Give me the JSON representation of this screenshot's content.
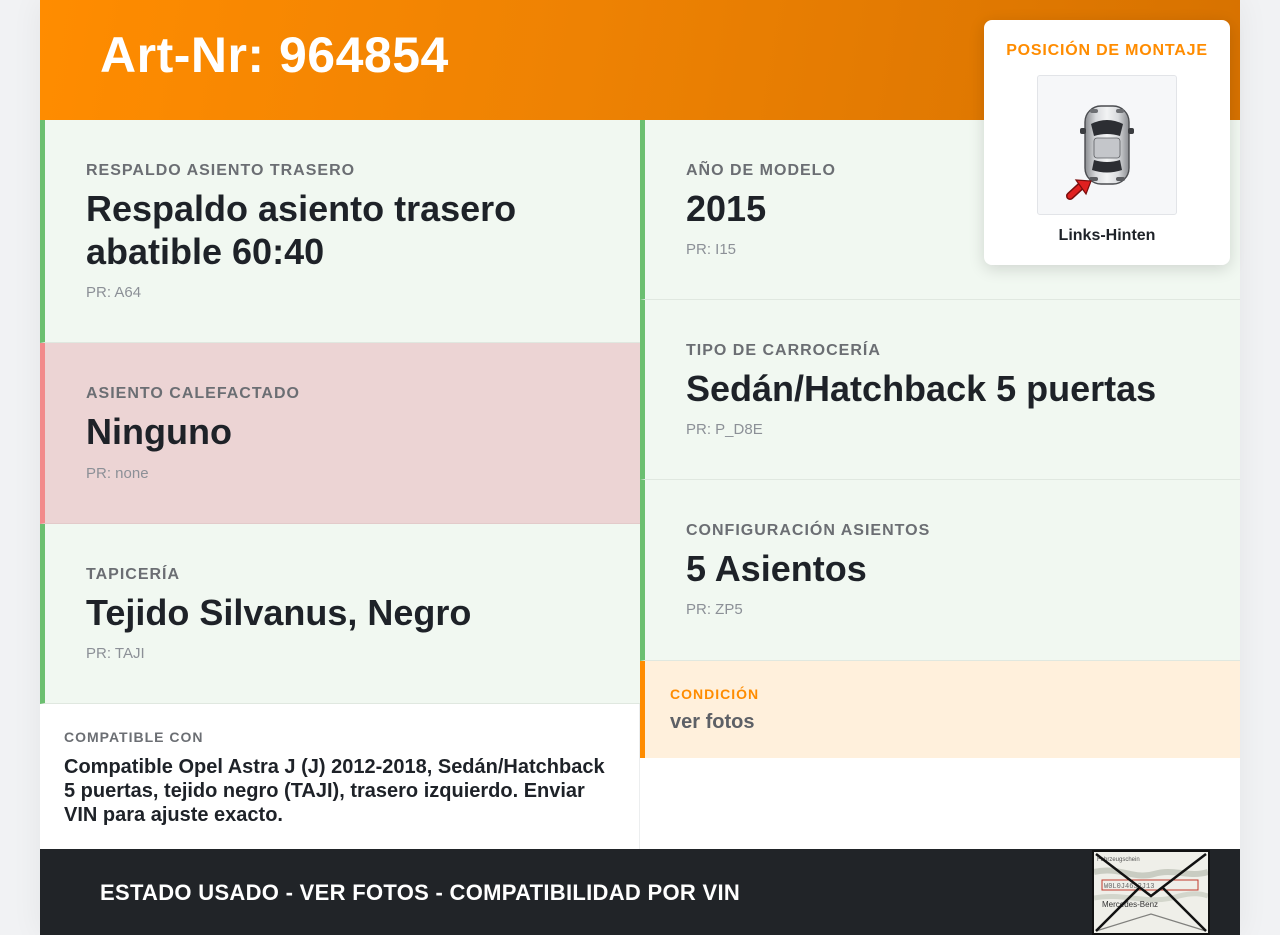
{
  "header": {
    "title": "Art-Nr: 964854"
  },
  "left_cells": [
    {
      "label": "RESPALDO ASIENTO TRASERO",
      "value": "Respaldo asiento trasero abatible 60:40",
      "pr": "PR: A64",
      "status": "ok"
    },
    {
      "label": "ASIENTO CALEFACTADO",
      "value": "Ninguno",
      "pr": "PR: none",
      "status": "missing"
    },
    {
      "label": "TAPICERÍA",
      "value": "Tejido Silvanus, Negro",
      "pr": "PR: TAJI",
      "status": "ok"
    }
  ],
  "right_cells": [
    {
      "label": "AÑO DE MODELO",
      "value": "2015",
      "pr": "PR: I15",
      "status": "ok"
    },
    {
      "label": "TIPO DE CARROCERÍA",
      "value": "Sedán/Hatchback 5 puertas",
      "pr": "PR: P_D8E",
      "status": "ok"
    },
    {
      "label": "CONFIGURACIÓN ASIENTOS",
      "value": "5 Asientos",
      "pr": "PR: ZP5",
      "status": "ok"
    }
  ],
  "compatible": {
    "label": "COMPATIBLE CON",
    "text": "Compatible Opel Astra J (J) 2012-2018, Sedán/Hatchback 5 puertas, tejido negro (TAJI), trasero izquierdo. Enviar VIN para ajuste exacto."
  },
  "condition": {
    "label": "CONDICIÓN",
    "value": "ver fotos"
  },
  "mounting": {
    "label": "POSICIÓN DE MONTAJE",
    "position": "Links-Hinten",
    "icon": "car-top-view-icon"
  },
  "footer": {
    "text": "ESTADO USADO - VER FOTOS - COMPATIBILIDAD POR VIN",
    "stamp_text": [
      "Fahrzeugschein",
      "Mercedes-Benz"
    ]
  },
  "colors": {
    "accent": "#ff8c00",
    "ok_border": "#6cbf70",
    "ok_bg": "#f1f8f1",
    "missing_border": "#f28b8b",
    "missing_bg": "#ecd4d4",
    "footer_bg": "#212428"
  }
}
